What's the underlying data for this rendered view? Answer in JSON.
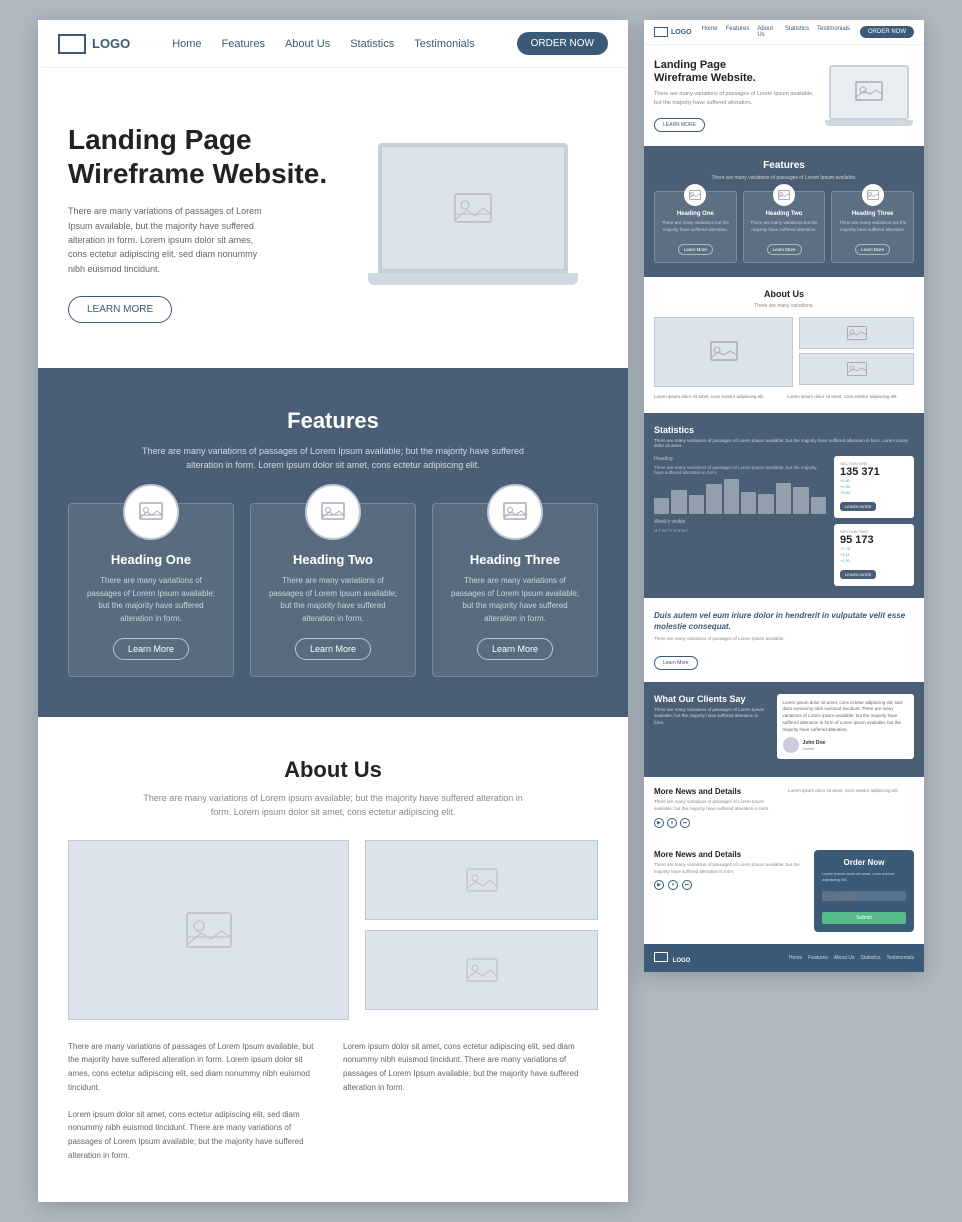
{
  "leftPanel": {
    "nav": {
      "logo": "LOGO",
      "links": [
        "Home",
        "Features",
        "About Us",
        "Statistics",
        "Testimonials"
      ],
      "ctaButton": "ORDER NOW"
    },
    "hero": {
      "title": "Landing Page\nWireframe Website.",
      "description": "There are many variations of passages of Lorem Ipsum available, but the majority have suffered alteration in form. Lorem ipsum dolor sit ames, cons ectetur adipiscing elit, sed diam nonummy nibh euismod tincidunt.",
      "ctaButton": "LEARN MORE"
    },
    "features": {
      "title": "Features",
      "subtitle": "There are many variations of passages of Lorem Ipsum available; but the majority have suffered alteration in form. Lorem ipsum dolor sit amet, cons ectetur adipiscing elit.",
      "cards": [
        {
          "title": "Heading One",
          "description": "There are many variations of passages of Lorem Ipsum available; but the majority have suffered alteration in form.",
          "button": "Learn More"
        },
        {
          "title": "Heading Two",
          "description": "There are many variations of passages of Lorem Ipsum available; but the majority have suffered alteration in form.",
          "button": "Learn More"
        },
        {
          "title": "Heading Three",
          "description": "There are many variations of passages of Lorem Ipsum available; but the majority have suffered alteration in form.",
          "button": "Learn More"
        }
      ]
    },
    "aboutUs": {
      "title": "About Us",
      "subtitle": "There are many variations of Lorem ipsum available; but the majority have suffered alteration in form. Lorem ipsum dolor sit amet, cons ectetur adipiscing elit.",
      "textLeft": "There are many variations of passages of Lorem Ipsum available, but the majority have suffered alteration in form. Lorem ipsum dolor sit ames, cons ectetur adipiscing elit, sed diam nonummy nibh euismod tincidunt.\n\nLorem ipsum dolor sit amet, cons ectetur adipiscing elit, sed diam nonummy nibh euismod tincidunt. There are many variations of passages of Lorem Ipsum available; but the majority have suffered alteration in form.",
      "textRight": "Lorem ipsum dolor sit amet, cons ectetur adipiscing elit, sed diam nonummy nibh euismod tincidunt. There are many variations of passages of Lorem Ipsum available; but the majority have suffered alteration in form."
    }
  },
  "rightPanel": {
    "nav": {
      "logo": "LOGO",
      "links": [
        "Home",
        "Features",
        "About Us",
        "Statistics",
        "Testimonials"
      ],
      "ctaButton": "ORDER NOW"
    },
    "hero": {
      "title": "Landing Page\nWireframe Website.",
      "description": "There are many variations of passages of Lorem Ipsum available, but the majority have suffered alteration.",
      "ctaButton": "LEARN MORE"
    },
    "features": {
      "title": "Features",
      "subtitle": "There are many variations of passages of Lorem Ipsum available.",
      "cards": [
        {
          "title": "Heading One",
          "description": "There are many variations but the majority have suffered alteration.",
          "button": "Learn More"
        },
        {
          "title": "Heading Two",
          "description": "There are many variations but the majority have suffered alteration.",
          "button": "Learn More"
        },
        {
          "title": "Heading Three",
          "description": "There are many variations but the majority have suffered alteration.",
          "button": "Learn More"
        }
      ]
    },
    "aboutUs": {
      "title": "About Us",
      "subtitle": "There are many variations.",
      "textLeft": "Lorem ipsum dolor sit amet, cons ectetur adipiscing elit.",
      "textRight": "Lorem ipsum dolor sit amet, cons ectetur adipiscing elit."
    },
    "statistics": {
      "title": "Statistics",
      "subtitle": "There are many variations of passages of Lorem Ipsum available; but the majority have suffered alteration in form. Lorem ipsum dolor sit amet.",
      "stat1": {
        "section": "SECTION ONE",
        "number": "135 371",
        "changes": [
          "+0.81",
          "+0.93",
          "+0.83"
        ]
      },
      "stat2": {
        "section": "SECTION TWO",
        "number": "95 173",
        "changes": [
          "+1.79",
          "+3.11",
          "+1.91"
        ]
      },
      "bars": [
        35,
        55,
        42,
        68,
        80,
        50,
        45,
        70,
        60,
        38
      ]
    },
    "testimonials": {
      "quote": "Duis autem vel eum iriure dolor in hendrerit in vulputate velit esse molestie consequat.",
      "description": "There are many variations of passages of Lorem Ipsum available.",
      "button": "Learn More"
    },
    "clients": {
      "title": "What Our Clients Say",
      "subtitle": "There are many variations of passages of Lorem Ipsum available; but the majority have suffered alteration in form.",
      "card": {
        "text": "Lorem ipsum dolor sit amet, cons ectetur adipiscing elit, sed diam nonummy nibh euismod tincidunt. There are many variations of Lorem ipsum available; but the majority have suffered alteration in form of Lorem ipsum available; but the majority have suffered alteration.",
        "name": "John Doe",
        "role": "Owner"
      }
    },
    "news": {
      "title": "More News and Details",
      "subtitle": "There are many variations of passages of Lorem Ipsum available; but the majority have suffered alteration in form.",
      "rightText": "Lorem ipsum dolor sit amet, cons ectetur adipiscing elit."
    },
    "order": {
      "title": "Order Now",
      "description": "Lorem ipsum dolor sit amet, cons ectetur adipiscing elit.",
      "emailPlaceholder": "Email",
      "submitButton": "Submit"
    },
    "footer": {
      "logo": "LOGO",
      "links": [
        "Home",
        "Features",
        "About Us",
        "Statistics",
        "Testimonials"
      ]
    }
  },
  "icons": {
    "image": "🖼",
    "play": "▶",
    "pause": "⏸",
    "next": "⏭"
  }
}
